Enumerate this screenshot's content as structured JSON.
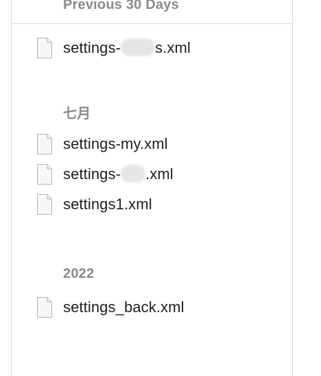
{
  "sections": [
    {
      "header": "Previous 30 Days",
      "files": [
        {
          "prefix": "settings-",
          "suffix": "s.xml",
          "redacted": true
        }
      ]
    },
    {
      "header": "七月",
      "files": [
        {
          "prefix": "settings-my.xml",
          "suffix": "",
          "redacted": false
        },
        {
          "prefix": "settings-",
          "suffix": ".xml",
          "redacted": true
        },
        {
          "prefix": "settings1.xml",
          "suffix": "",
          "redacted": false
        }
      ]
    },
    {
      "header": "2022",
      "files": [
        {
          "prefix": "settings_back.xml",
          "suffix": "",
          "redacted": false
        }
      ]
    }
  ],
  "icons": {
    "file": "document-icon"
  },
  "colors": {
    "section_header": "#8a8a8a",
    "file_name": "#1e1e1e",
    "divider": "#d9d9d9",
    "background": "#ffffff"
  }
}
